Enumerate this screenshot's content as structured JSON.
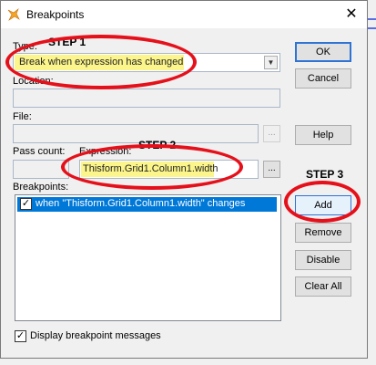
{
  "window": {
    "title": "Breakpoints",
    "close_symbol": "✕",
    "app_icon": "fox-icon"
  },
  "form": {
    "type_label": "Type:",
    "type_value": "Break when expression has changed",
    "location_label": "Location:",
    "file_label": "File:",
    "pass_count_label": "Pass count:",
    "expression_label": "Expression:",
    "expression_value": "Thisform.Grid1.Column1.width",
    "breakpoints_label": "Breakpoints:",
    "breakpoints": [
      {
        "text": "when \"Thisform.Grid1.Column1.width\" changes",
        "checked": true,
        "selected": true
      }
    ],
    "display_messages_label": "Display breakpoint messages",
    "display_messages_checked": true,
    "browse_label": "..."
  },
  "buttons": {
    "ok": "OK",
    "cancel": "Cancel",
    "help": "Help",
    "add": "Add",
    "remove": "Remove",
    "disable": "Disable",
    "clear_all": "Clear All"
  },
  "annotations": {
    "step1": "STEP 1",
    "step2": "STEP 2",
    "step3": "STEP 3",
    "ring_color": "#e5101a",
    "highlight_color": "#fbf58b"
  },
  "colors": {
    "selection": "#0078d7",
    "default_button_border": "#2f73d4"
  }
}
